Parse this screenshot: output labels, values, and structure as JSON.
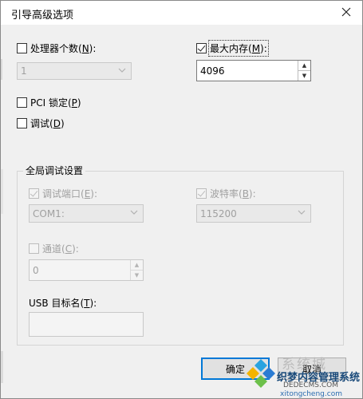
{
  "window": {
    "title": "引导高级选项"
  },
  "processors": {
    "label": "处理器个数(",
    "mnemonic": "N",
    "label_end": "):",
    "checked": false,
    "value": "1"
  },
  "max_memory": {
    "label": "最大内存(",
    "mnemonic": "M",
    "label_end": "):",
    "checked": true,
    "value": "4096"
  },
  "pci_lock": {
    "label": "PCI 锁定(",
    "mnemonic": "P",
    "label_end": ")",
    "checked": false
  },
  "debug": {
    "label": "调试(",
    "mnemonic": "D",
    "label_end": ")",
    "checked": false
  },
  "global_debug": {
    "title": "全局调试设置",
    "debug_port": {
      "label": "调试端口(",
      "mnemonic": "E",
      "label_end": "):",
      "checked": true,
      "value": "COM1:"
    },
    "baud_rate": {
      "label": "波特率(",
      "mnemonic": "B",
      "label_end": "):",
      "checked": true,
      "value": "115200"
    },
    "channel": {
      "label": "通道(",
      "mnemonic": "C",
      "label_end": "):",
      "checked": false,
      "value": "0"
    },
    "usb_target": {
      "label": "USB 目标名(",
      "mnemonic": "T",
      "label_end": "):",
      "value": ""
    }
  },
  "buttons": {
    "ok": "确定",
    "cancel": "取消"
  },
  "watermark": {
    "brand": "织梦内容管理系统",
    "url": "DEDECMS.COM",
    "site": "xitongcheng.com",
    "big": "系统城"
  },
  "colors": {
    "accent": "#0078d7",
    "disabled_text": "#a0a0a0"
  }
}
